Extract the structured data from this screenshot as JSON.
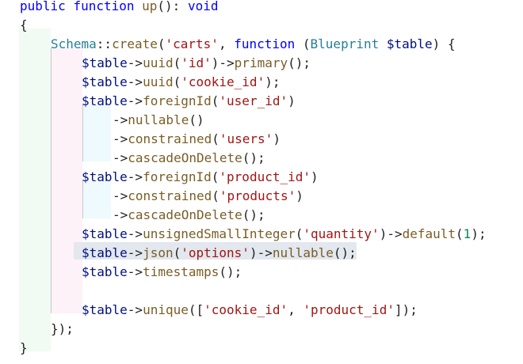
{
  "editor": {
    "lines": [
      {
        "id": "l1",
        "tokens": [
          [
            "kw",
            "public"
          ],
          [
            "op",
            " "
          ],
          [
            "kw",
            "function"
          ],
          [
            "op",
            " "
          ],
          [
            "fn",
            "up"
          ],
          [
            "op",
            "(): "
          ],
          [
            "kw",
            "void"
          ]
        ]
      },
      {
        "id": "l2",
        "tokens": [
          [
            "op",
            "{"
          ]
        ]
      },
      {
        "id": "l3",
        "tokens": [
          [
            "ty",
            "Schema"
          ],
          [
            "op",
            "::"
          ],
          [
            "fn",
            "create"
          ],
          [
            "op",
            "("
          ],
          [
            "str",
            "'carts'"
          ],
          [
            "op",
            ", "
          ],
          [
            "kw",
            "function"
          ],
          [
            "op",
            " ("
          ],
          [
            "ty",
            "Blueprint"
          ],
          [
            "op",
            " "
          ],
          [
            "var",
            "$table"
          ],
          [
            "op",
            ") {"
          ]
        ]
      },
      {
        "id": "l4",
        "tokens": [
          [
            "var",
            "$table"
          ],
          [
            "op",
            "->"
          ],
          [
            "fn",
            "uuid"
          ],
          [
            "op",
            "("
          ],
          [
            "str",
            "'id'"
          ],
          [
            "op",
            ")->"
          ],
          [
            "fn",
            "primary"
          ],
          [
            "op",
            "();"
          ]
        ]
      },
      {
        "id": "l5",
        "tokens": [
          [
            "var",
            "$table"
          ],
          [
            "op",
            "->"
          ],
          [
            "fn",
            "uuid"
          ],
          [
            "op",
            "("
          ],
          [
            "str",
            "'cookie_id'"
          ],
          [
            "op",
            ");"
          ]
        ]
      },
      {
        "id": "l6",
        "tokens": [
          [
            "var",
            "$table"
          ],
          [
            "op",
            "->"
          ],
          [
            "fn",
            "foreignId"
          ],
          [
            "op",
            "("
          ],
          [
            "str",
            "'user_id'"
          ],
          [
            "op",
            ")"
          ]
        ]
      },
      {
        "id": "l7",
        "tokens": [
          [
            "op",
            "->"
          ],
          [
            "fn",
            "nullable"
          ],
          [
            "op",
            "()"
          ]
        ]
      },
      {
        "id": "l8",
        "tokens": [
          [
            "op",
            "->"
          ],
          [
            "fn",
            "constrained"
          ],
          [
            "op",
            "("
          ],
          [
            "str",
            "'users'"
          ],
          [
            "op",
            ")"
          ]
        ]
      },
      {
        "id": "l9",
        "tokens": [
          [
            "op",
            "->"
          ],
          [
            "fn",
            "cascadeOnDelete"
          ],
          [
            "op",
            "();"
          ]
        ]
      },
      {
        "id": "l10",
        "tokens": [
          [
            "var",
            "$table"
          ],
          [
            "op",
            "->"
          ],
          [
            "fn",
            "foreignId"
          ],
          [
            "op",
            "("
          ],
          [
            "str",
            "'product_id'"
          ],
          [
            "op",
            ")"
          ]
        ]
      },
      {
        "id": "l11",
        "tokens": [
          [
            "op",
            "->"
          ],
          [
            "fn",
            "constrained"
          ],
          [
            "op",
            "("
          ],
          [
            "str",
            "'products'"
          ],
          [
            "op",
            ")"
          ]
        ]
      },
      {
        "id": "l12",
        "tokens": [
          [
            "op",
            "->"
          ],
          [
            "fn",
            "cascadeOnDelete"
          ],
          [
            "op",
            "();"
          ]
        ]
      },
      {
        "id": "l13",
        "tokens": [
          [
            "var",
            "$table"
          ],
          [
            "op",
            "->"
          ],
          [
            "fn",
            "unsignedSmallInteger"
          ],
          [
            "op",
            "("
          ],
          [
            "str",
            "'quantity'"
          ],
          [
            "op",
            ")->"
          ],
          [
            "fn",
            "default"
          ],
          [
            "op",
            "("
          ],
          [
            "num",
            "1"
          ],
          [
            "op",
            ");"
          ]
        ]
      },
      {
        "id": "l14",
        "tokens": [
          [
            "var",
            "$table"
          ],
          [
            "op",
            "->"
          ],
          [
            "fn",
            "json"
          ],
          [
            "op",
            "("
          ],
          [
            "str",
            "'options'"
          ],
          [
            "op",
            ")->"
          ],
          [
            "fn",
            "nullable"
          ],
          [
            "op",
            "();"
          ]
        ]
      },
      {
        "id": "l15",
        "tokens": [
          [
            "var",
            "$table"
          ],
          [
            "op",
            "->"
          ],
          [
            "fn",
            "timestamps"
          ],
          [
            "op",
            "();"
          ]
        ]
      },
      {
        "id": "l16",
        "tokens": []
      },
      {
        "id": "l17",
        "tokens": [
          [
            "var",
            "$table"
          ],
          [
            "op",
            "->"
          ],
          [
            "fn",
            "unique"
          ],
          [
            "op",
            "(["
          ],
          [
            "str",
            "'cookie_id'"
          ],
          [
            "op",
            ", "
          ],
          [
            "str",
            "'product_id'"
          ],
          [
            "op",
            "]);"
          ]
        ]
      },
      {
        "id": "l18",
        "tokens": [
          [
            "op",
            "});"
          ]
        ]
      },
      {
        "id": "l19",
        "tokens": [
          [
            "op",
            "}"
          ]
        ]
      }
    ]
  },
  "colors": {
    "keyword": "#0000ff",
    "type": "#267f99",
    "function": "#795e26",
    "string": "#a31515",
    "variable": "#001080",
    "number": "#098658"
  }
}
